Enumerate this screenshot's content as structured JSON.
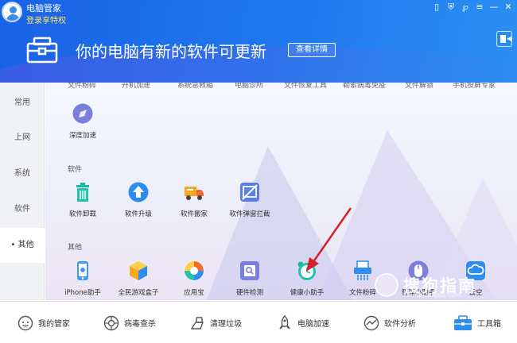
{
  "header": {
    "app_title": "电脑管家",
    "login_link": "登录享特权",
    "banner_text": "你的电脑有新的软件可更新",
    "detail_button": "查看详情"
  },
  "sidebar": {
    "items": [
      {
        "label": "常用"
      },
      {
        "label": "上网"
      },
      {
        "label": "系统"
      },
      {
        "label": "软件"
      },
      {
        "label": "• 其他",
        "active": true
      }
    ]
  },
  "content": {
    "cut_row": [
      "文件粉碎",
      "开机加速",
      "系统急救箱",
      "电脑诊所",
      "文件恢复工具",
      "勒索病毒免疫",
      "文件解锁",
      "手机投屏专家"
    ],
    "deep_accel": {
      "label": "深度加速",
      "icon": "rocket-icon"
    },
    "software_section": {
      "title": "软件",
      "apps": [
        {
          "label": "软件卸载",
          "icon": "trash-icon"
        },
        {
          "label": "软件升级",
          "icon": "upgrade-arrow-icon"
        },
        {
          "label": "软件搬家",
          "icon": "truck-icon"
        },
        {
          "label": "软件弹窗拦截",
          "icon": "popup-block-icon"
        }
      ]
    },
    "other_section": {
      "title": "其他",
      "apps": [
        {
          "label": "iPhone助手",
          "icon": "iphone-icon"
        },
        {
          "label": "全民游戏盒子",
          "icon": "game-box-icon"
        },
        {
          "label": "应用宝",
          "icon": "app-store-icon"
        },
        {
          "label": "硬件检测",
          "icon": "chip-icon"
        },
        {
          "label": "健康小助手",
          "icon": "alarm-clock-icon"
        },
        {
          "label": "文件粉碎",
          "icon": "shredder-icon"
        },
        {
          "label": "管理小助手",
          "icon": "mouse-icon"
        },
        {
          "label": "云空",
          "icon": "cloud-icon"
        }
      ]
    }
  },
  "bottom_tabs": [
    {
      "label": "我的管家",
      "icon": "face-icon"
    },
    {
      "label": "病毒查杀",
      "icon": "virus-icon"
    },
    {
      "label": "清理垃圾",
      "icon": "broom-icon"
    },
    {
      "label": "电脑加速",
      "icon": "rocket-icon"
    },
    {
      "label": "软件分析",
      "icon": "chart-icon"
    },
    {
      "label": "工具箱",
      "icon": "toolbox-icon",
      "active": true
    }
  ],
  "watermark": {
    "text": "搜狗指南",
    "url": "zhinan.sogou.com"
  },
  "colors": {
    "header_blue": "#1f78ee",
    "accent_red_arrow": "#d8202a"
  }
}
